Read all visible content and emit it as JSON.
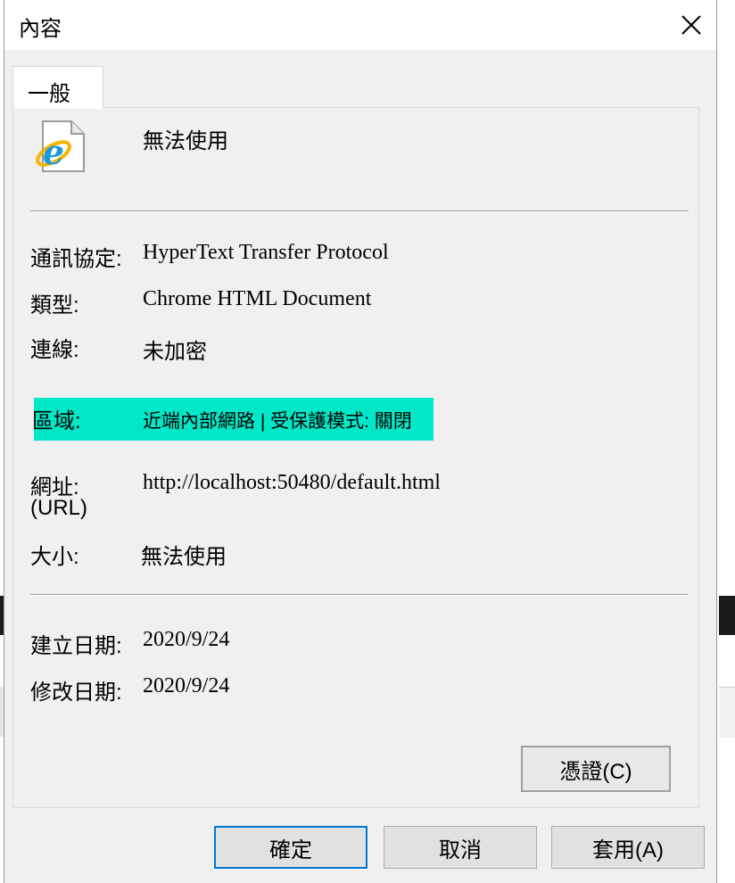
{
  "dialog": {
    "title": "內容",
    "tab": "一般",
    "name": "無法使用",
    "fields": [
      {
        "label": "通訊協定:",
        "value": "HyperText Transfer Protocol"
      },
      {
        "label": "類型:",
        "value": "Chrome HTML Document"
      },
      {
        "label": "連線:",
        "value": "未加密"
      },
      {
        "label": "區域:",
        "value": "近端內部網路 | 受保護模式: 關閉"
      },
      {
        "label_line1": "網址:",
        "label_line2": "(URL)",
        "value": "http://localhost:50480/default.html"
      },
      {
        "label": "大小:",
        "value": "無法使用"
      },
      {
        "label": "建立日期:",
        "value": "2020/9/24"
      },
      {
        "label": "修改日期:",
        "value": "2020/9/24"
      }
    ],
    "highlight_color": "#00e8c8",
    "buttons": {
      "certificate": "憑證(C)",
      "ok": "確定",
      "cancel": "取消",
      "apply": "套用(A)"
    }
  },
  "icons": {
    "close": "close-icon",
    "file": "internet-explorer-file-icon"
  }
}
